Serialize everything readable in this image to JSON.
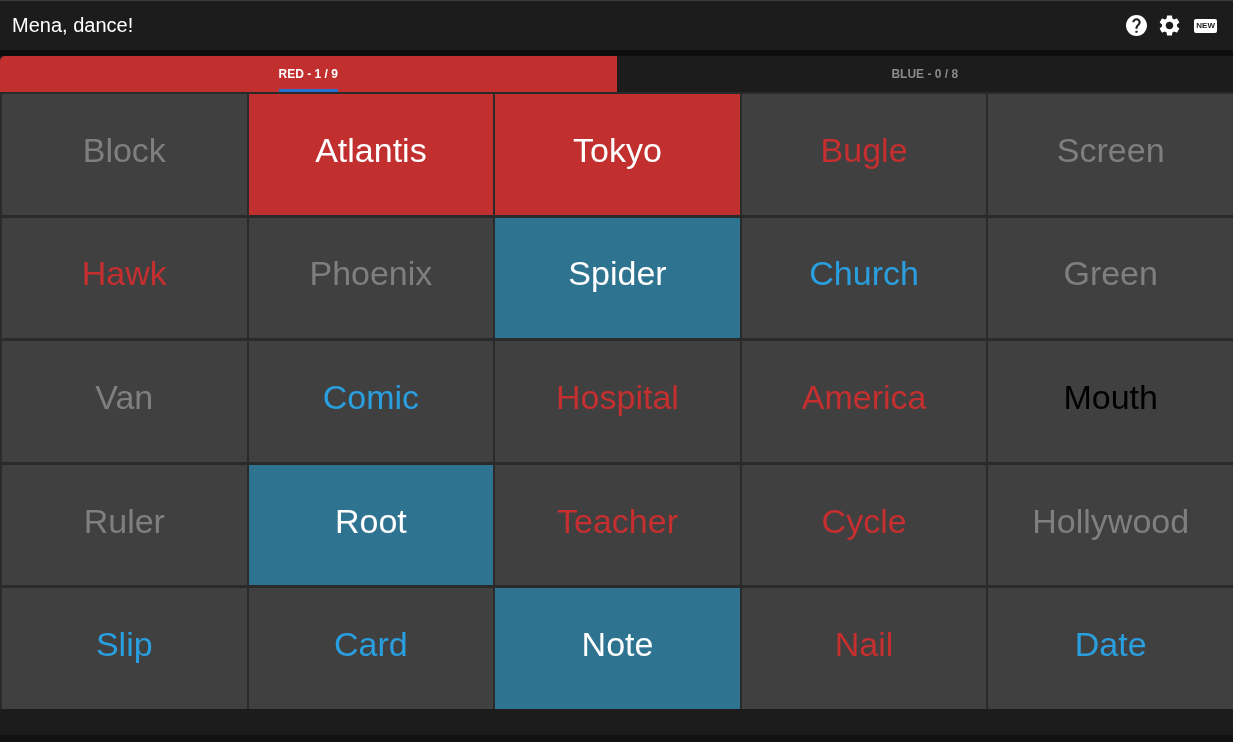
{
  "app_bar": {
    "title": "Mena, dance!",
    "new_badge": "NEW"
  },
  "tabs": [
    {
      "label": "RED - 1 / 9",
      "selected": true
    },
    {
      "label": "BLUE - 0 / 8",
      "selected": false
    }
  ],
  "cards": [
    {
      "word": "Block",
      "kind": "neutral",
      "revealed": false
    },
    {
      "word": "Atlantis",
      "kind": "red",
      "revealed": true
    },
    {
      "word": "Tokyo",
      "kind": "red",
      "revealed": true
    },
    {
      "word": "Bugle",
      "kind": "red",
      "revealed": false
    },
    {
      "word": "Screen",
      "kind": "neutral",
      "revealed": false
    },
    {
      "word": "Hawk",
      "kind": "red",
      "revealed": false
    },
    {
      "word": "Phoenix",
      "kind": "neutral",
      "revealed": false
    },
    {
      "word": "Spider",
      "kind": "blue",
      "revealed": true
    },
    {
      "word": "Church",
      "kind": "blue",
      "revealed": false
    },
    {
      "word": "Green",
      "kind": "neutral",
      "revealed": false
    },
    {
      "word": "Van",
      "kind": "neutral",
      "revealed": false
    },
    {
      "word": "Comic",
      "kind": "blue",
      "revealed": false
    },
    {
      "word": "Hospital",
      "kind": "red",
      "revealed": false
    },
    {
      "word": "America",
      "kind": "red",
      "revealed": false
    },
    {
      "word": "Mouth",
      "kind": "assassin",
      "revealed": false
    },
    {
      "word": "Ruler",
      "kind": "neutral",
      "revealed": false
    },
    {
      "word": "Root",
      "kind": "blue",
      "revealed": true
    },
    {
      "word": "Teacher",
      "kind": "red",
      "revealed": false
    },
    {
      "word": "Cycle",
      "kind": "red",
      "revealed": false
    },
    {
      "word": "Hollywood",
      "kind": "neutral",
      "revealed": false
    },
    {
      "word": "Slip",
      "kind": "blue",
      "revealed": false
    },
    {
      "word": "Card",
      "kind": "blue",
      "revealed": false
    },
    {
      "word": "Note",
      "kind": "blue",
      "revealed": true
    },
    {
      "word": "Nail",
      "kind": "red",
      "revealed": false
    },
    {
      "word": "Date",
      "kind": "blue",
      "revealed": false
    }
  ]
}
